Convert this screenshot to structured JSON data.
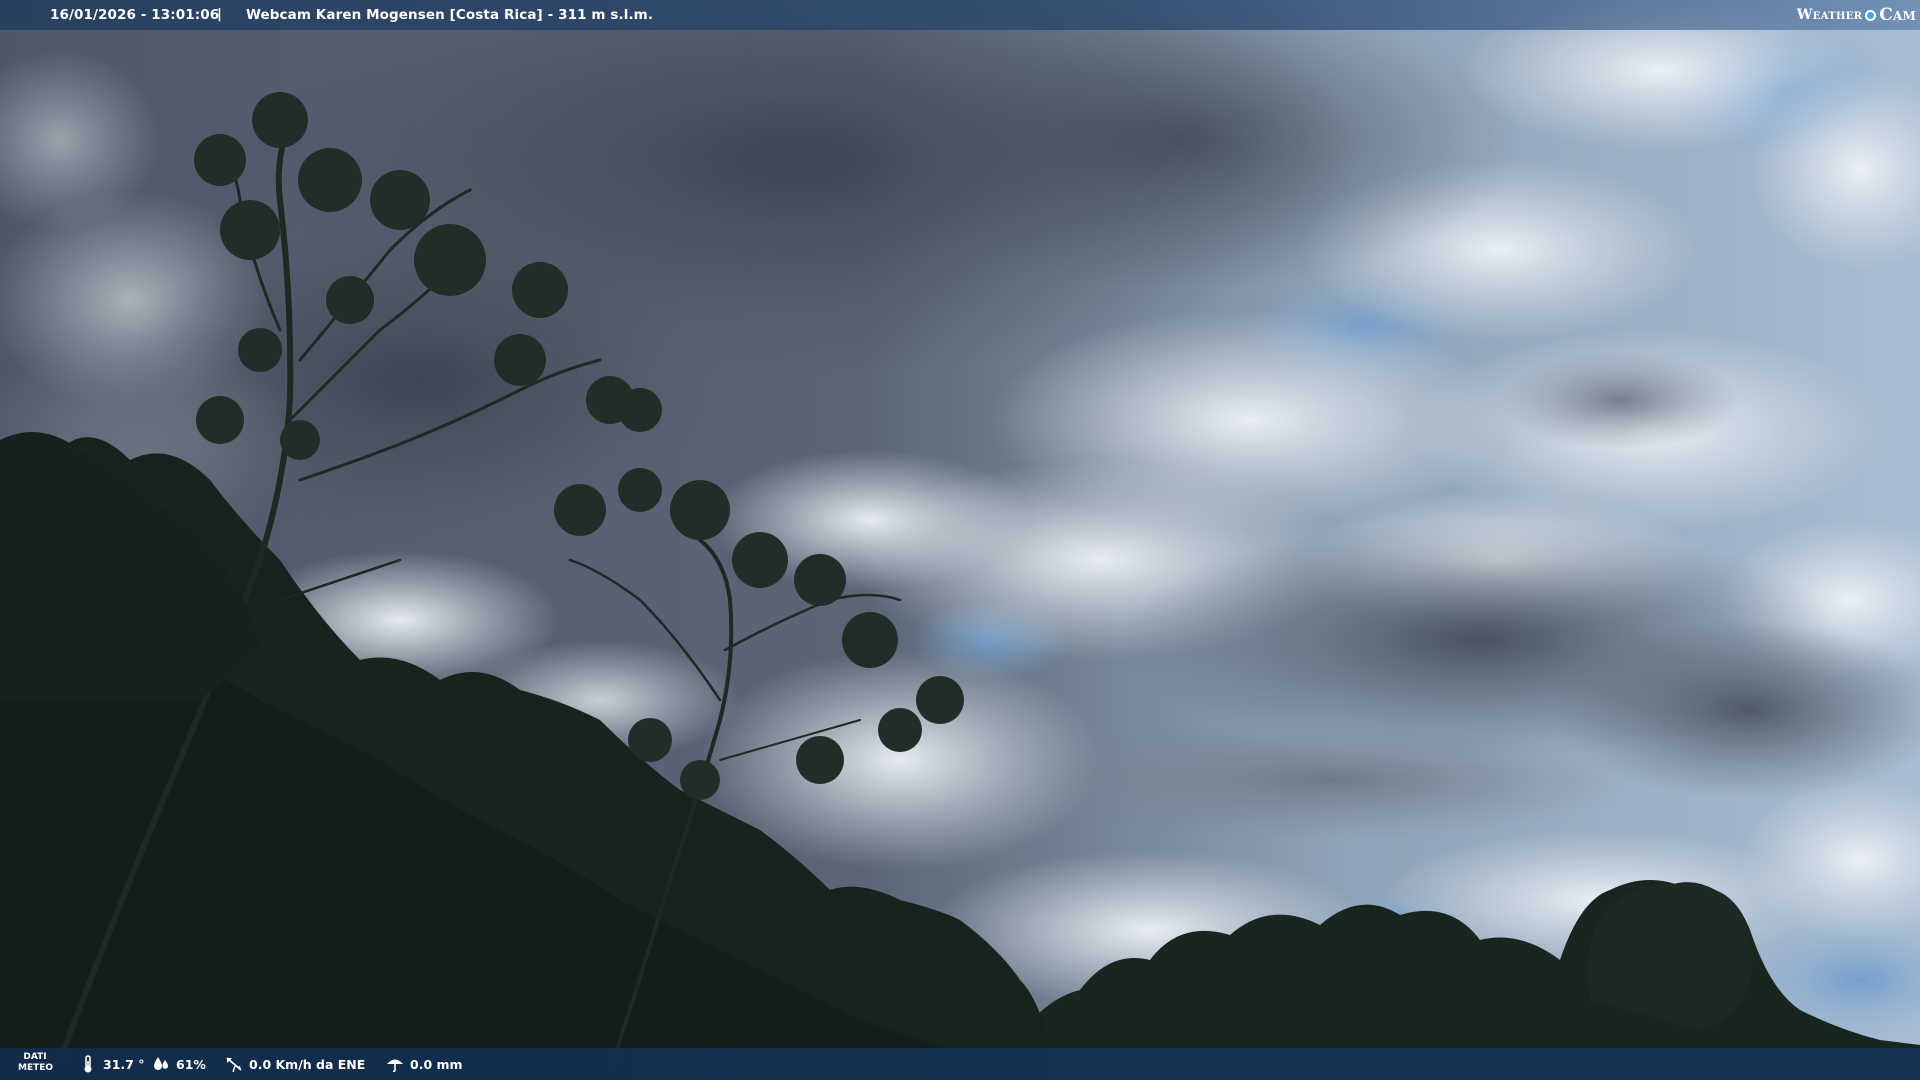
{
  "overlay": {
    "timestamp": "16/01/2026 - 13:01:06",
    "separator": "|",
    "location": "Webcam Karen Mogensen [Costa Rica]  - 311 m s.l.m.",
    "brand_weather": "Weather",
    "brand_cam": "Cam"
  },
  "weather": {
    "label_line1": "DATI",
    "label_line2": "METEO",
    "temperature": "31.7 °",
    "humidity": "61%",
    "wind": "0.0 Km/h da ENE",
    "rain": "0.0 mm"
  },
  "colors": {
    "bar_dark": "#1c3a60",
    "sky_blue": "#6f9ccc",
    "cloud_dark": "#4a5563",
    "cloud_light": "#e8edf3",
    "foliage": "#1a2a22",
    "accent": "#3fa7e6"
  }
}
